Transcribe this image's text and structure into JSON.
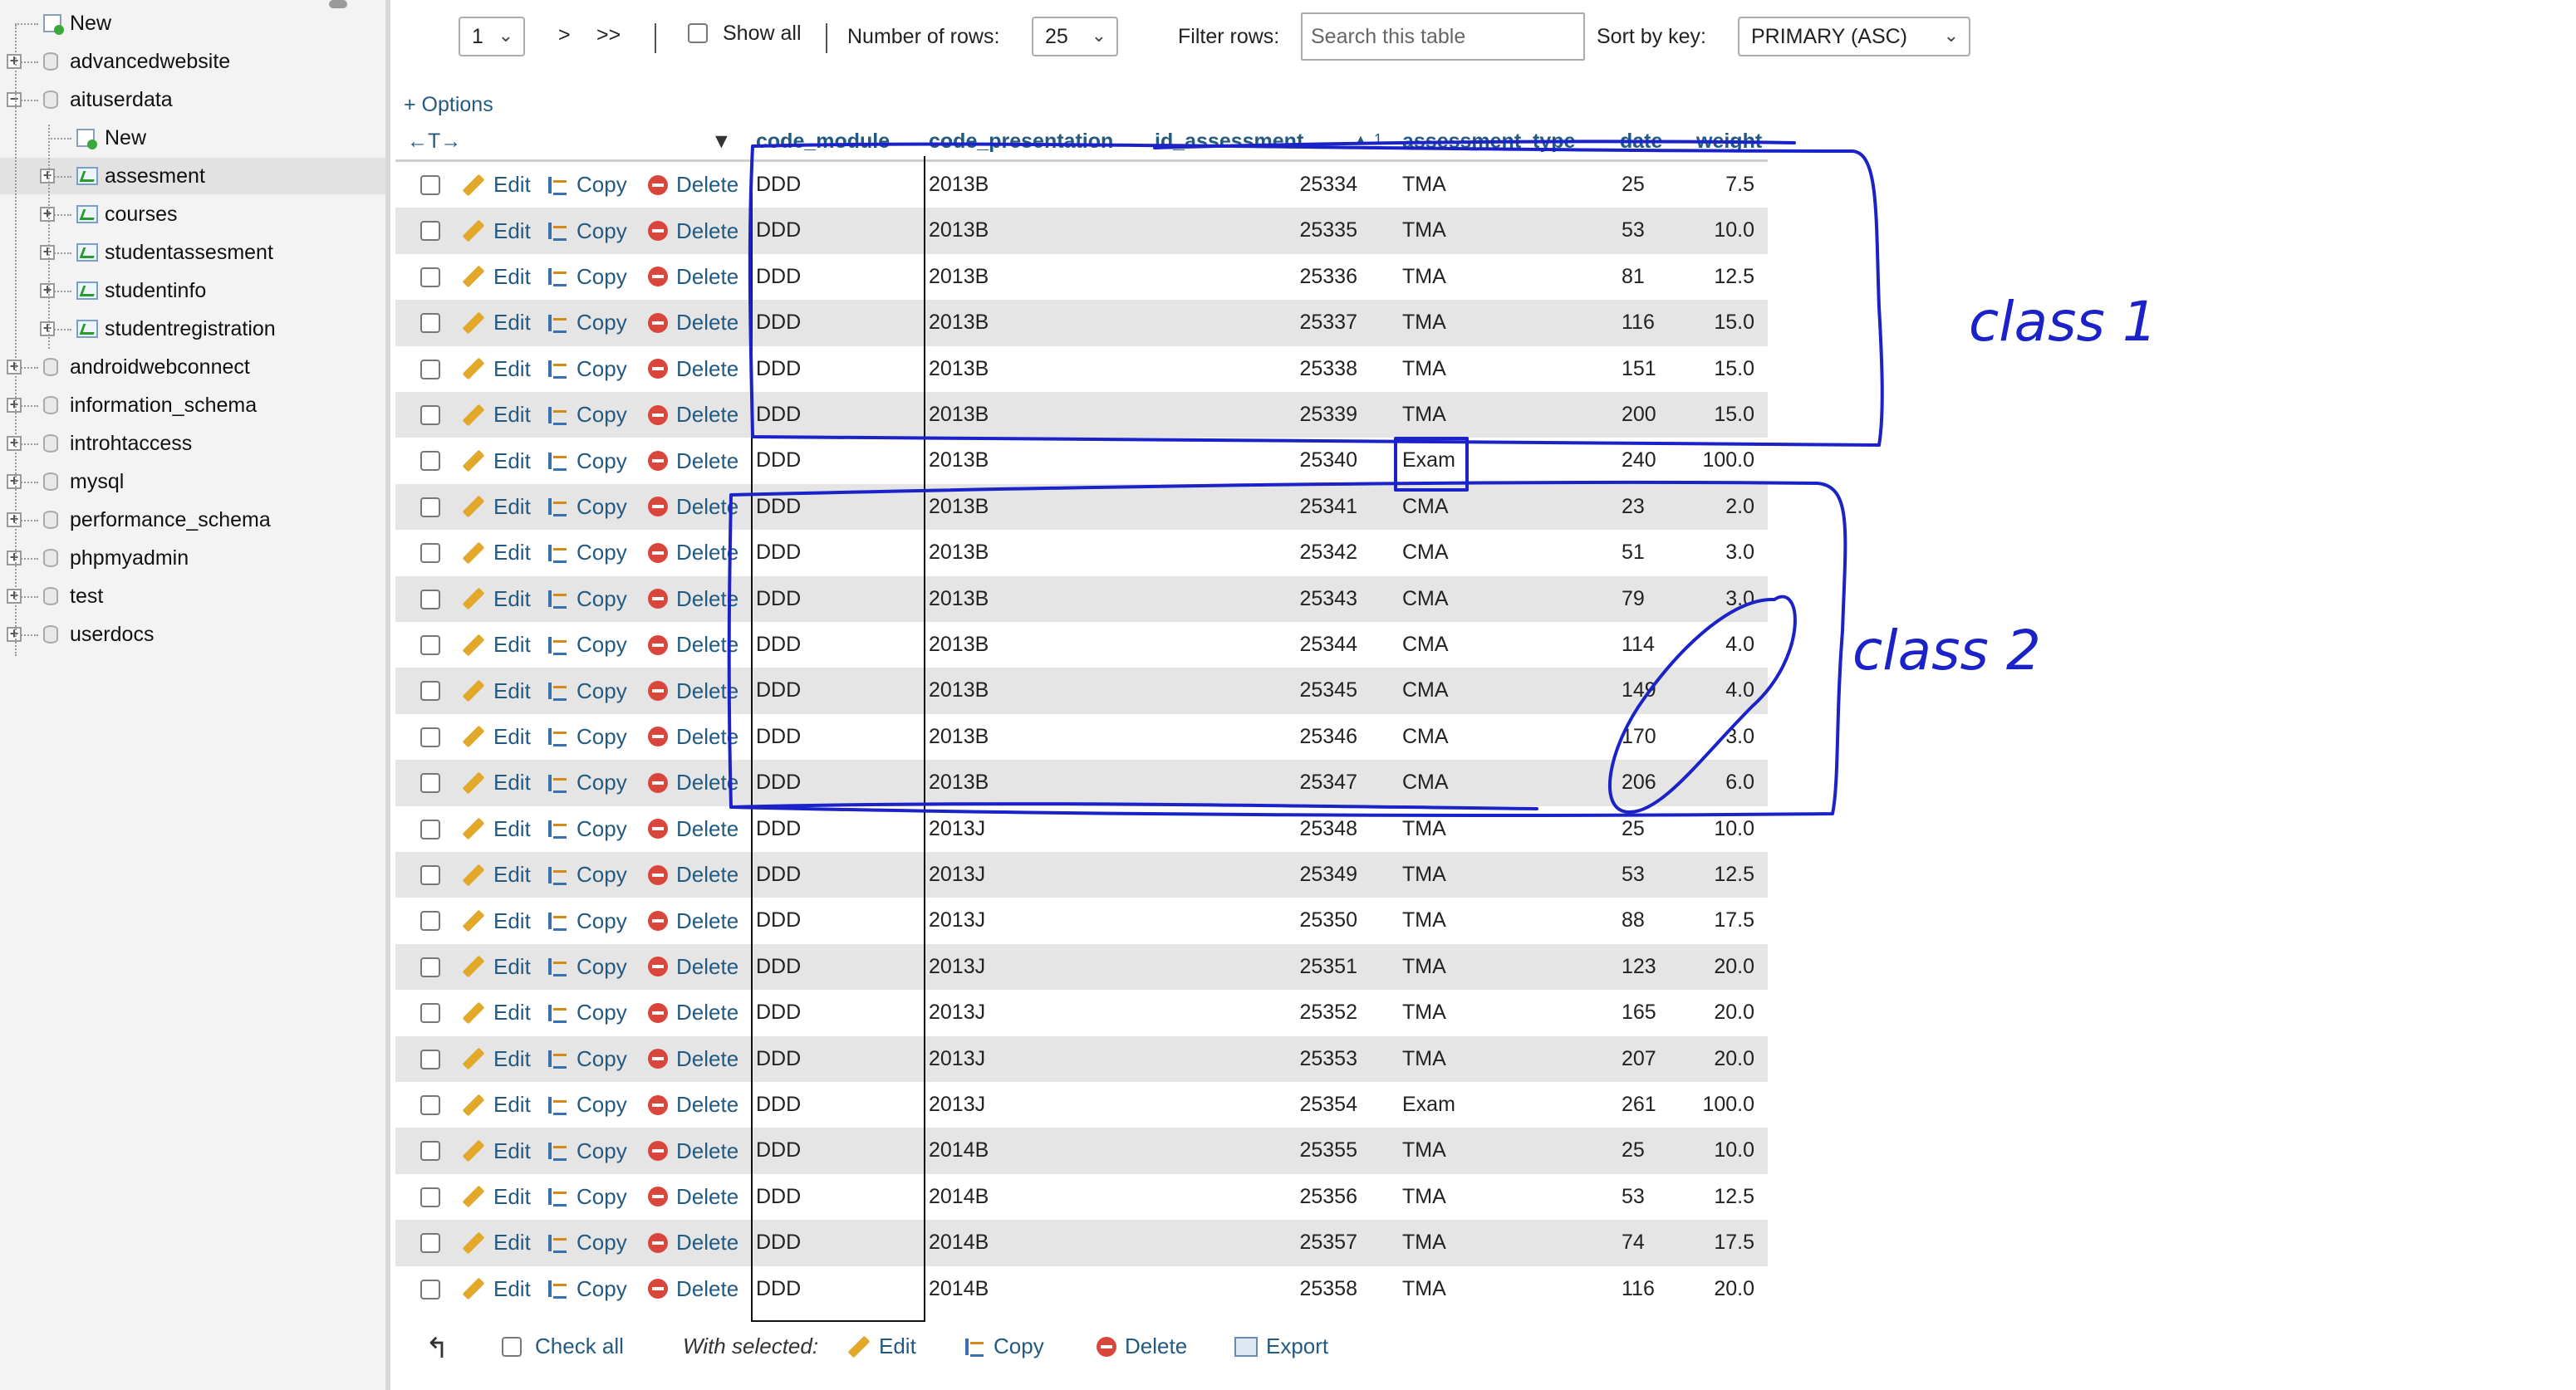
{
  "sidebar": {
    "items": [
      {
        "label": "New",
        "kind": "new",
        "level": 0
      },
      {
        "label": "advancedwebsite",
        "kind": "db",
        "level": 0
      },
      {
        "label": "aituserdata",
        "kind": "db-open",
        "level": 0
      },
      {
        "label": "New",
        "kind": "new",
        "level": 1
      },
      {
        "label": "assesment",
        "kind": "table",
        "level": 1,
        "selected": true
      },
      {
        "label": "courses",
        "kind": "table",
        "level": 1
      },
      {
        "label": "studentassesment",
        "kind": "table",
        "level": 1
      },
      {
        "label": "studentinfo",
        "kind": "table",
        "level": 1
      },
      {
        "label": "studentregistration",
        "kind": "table",
        "level": 1
      },
      {
        "label": "androidwebconnect",
        "kind": "db",
        "level": 0
      },
      {
        "label": "information_schema",
        "kind": "db",
        "level": 0
      },
      {
        "label": "introhtaccess",
        "kind": "db",
        "level": 0
      },
      {
        "label": "mysql",
        "kind": "db",
        "level": 0
      },
      {
        "label": "performance_schema",
        "kind": "db",
        "level": 0
      },
      {
        "label": "phpmyadmin",
        "kind": "db",
        "level": 0
      },
      {
        "label": "test",
        "kind": "db",
        "level": 0
      },
      {
        "label": "userdocs",
        "kind": "db",
        "level": 0
      }
    ]
  },
  "navigation": {
    "page_value": "1",
    "next_label": ">",
    "last_label": ">>",
    "show_all_label": "Show all",
    "rows_label": "Number of rows:",
    "rows_value": "25",
    "filter_label": "Filter rows:",
    "filter_placeholder": "Search this table",
    "sort_label": "Sort by key:",
    "sort_value": "PRIMARY (ASC)"
  },
  "options_label": "+ Options",
  "table": {
    "arrows": "←T→",
    "sort_order": "1",
    "columns": [
      "code_module",
      "code_presentation",
      "id_assessment",
      "assessment_type",
      "date",
      "weight"
    ],
    "actions": {
      "edit": "Edit",
      "copy": "Copy",
      "delete": "Delete"
    },
    "rows": [
      [
        "DDD",
        "2013B",
        "25334",
        "TMA",
        "25",
        "7.5"
      ],
      [
        "DDD",
        "2013B",
        "25335",
        "TMA",
        "53",
        "10.0"
      ],
      [
        "DDD",
        "2013B",
        "25336",
        "TMA",
        "81",
        "12.5"
      ],
      [
        "DDD",
        "2013B",
        "25337",
        "TMA",
        "116",
        "15.0"
      ],
      [
        "DDD",
        "2013B",
        "25338",
        "TMA",
        "151",
        "15.0"
      ],
      [
        "DDD",
        "2013B",
        "25339",
        "TMA",
        "200",
        "15.0"
      ],
      [
        "DDD",
        "2013B",
        "25340",
        "Exam",
        "240",
        "100.0"
      ],
      [
        "DDD",
        "2013B",
        "25341",
        "CMA",
        "23",
        "2.0"
      ],
      [
        "DDD",
        "2013B",
        "25342",
        "CMA",
        "51",
        "3.0"
      ],
      [
        "DDD",
        "2013B",
        "25343",
        "CMA",
        "79",
        "3.0"
      ],
      [
        "DDD",
        "2013B",
        "25344",
        "CMA",
        "114",
        "4.0"
      ],
      [
        "DDD",
        "2013B",
        "25345",
        "CMA",
        "149",
        "4.0"
      ],
      [
        "DDD",
        "2013B",
        "25346",
        "CMA",
        "170",
        "3.0"
      ],
      [
        "DDD",
        "2013B",
        "25347",
        "CMA",
        "206",
        "6.0"
      ],
      [
        "DDD",
        "2013J",
        "25348",
        "TMA",
        "25",
        "10.0"
      ],
      [
        "DDD",
        "2013J",
        "25349",
        "TMA",
        "53",
        "12.5"
      ],
      [
        "DDD",
        "2013J",
        "25350",
        "TMA",
        "88",
        "17.5"
      ],
      [
        "DDD",
        "2013J",
        "25351",
        "TMA",
        "123",
        "20.0"
      ],
      [
        "DDD",
        "2013J",
        "25352",
        "TMA",
        "165",
        "20.0"
      ],
      [
        "DDD",
        "2013J",
        "25353",
        "TMA",
        "207",
        "20.0"
      ],
      [
        "DDD",
        "2013J",
        "25354",
        "Exam",
        "261",
        "100.0"
      ],
      [
        "DDD",
        "2014B",
        "25355",
        "TMA",
        "25",
        "10.0"
      ],
      [
        "DDD",
        "2014B",
        "25356",
        "TMA",
        "53",
        "12.5"
      ],
      [
        "DDD",
        "2014B",
        "25357",
        "TMA",
        "74",
        "17.5"
      ],
      [
        "DDD",
        "2014B",
        "25358",
        "TMA",
        "116",
        "20.0"
      ]
    ]
  },
  "footer": {
    "check_all_label": "Check all",
    "with_selected_label": "With selected:",
    "edit_label": "Edit",
    "copy_label": "Copy",
    "delete_label": "Delete",
    "export_label": "Export"
  },
  "annotations": {
    "class1_label": "class 1",
    "class2_label": "class 2",
    "ink_color": "#1a22c8"
  },
  "colors": {
    "link": "#235a81",
    "row_alt": "#e5e5e5",
    "sidebar_bg": "#f3f3f3"
  }
}
